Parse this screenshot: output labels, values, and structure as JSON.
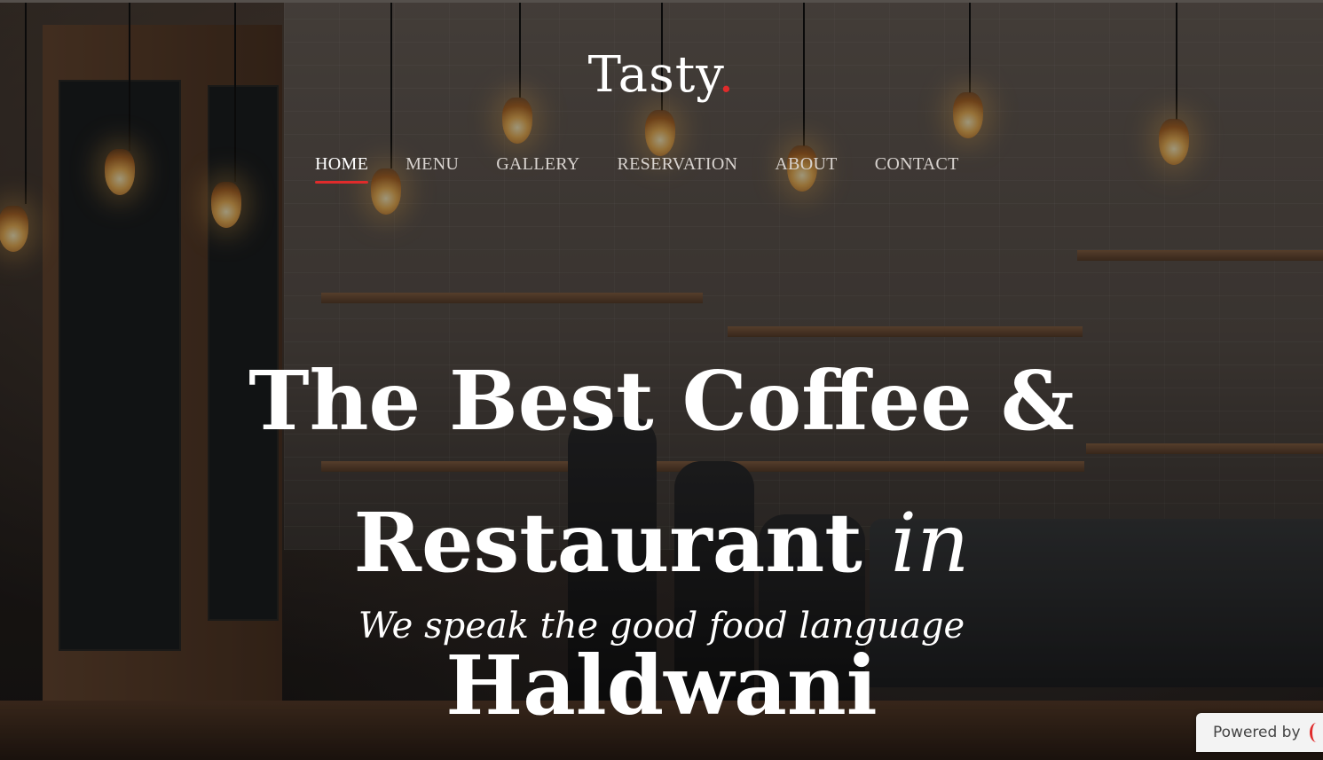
{
  "brand": {
    "name": "Tasty",
    "dot": ".",
    "dot_color": "#e02b2b"
  },
  "nav": {
    "items": [
      {
        "label": "HOME",
        "active": true
      },
      {
        "label": "MENU",
        "active": false
      },
      {
        "label": "GALLERY",
        "active": false
      },
      {
        "label": "RESERVATION",
        "active": false
      },
      {
        "label": "ABOUT",
        "active": false
      },
      {
        "label": "CONTACT",
        "active": false
      }
    ]
  },
  "hero": {
    "headline_main": "The Best Coffee & Restaurant",
    "headline_em": "in",
    "headline_city": "Haldwani",
    "tagline": "We speak the good food language",
    "background_image": "cafe-interior-with-hanging-bulbs"
  },
  "badge": {
    "label": "Powered by",
    "icon": "platform-logo-icon"
  },
  "colors": {
    "accent": "#e02b2b",
    "text": "#ffffff"
  }
}
